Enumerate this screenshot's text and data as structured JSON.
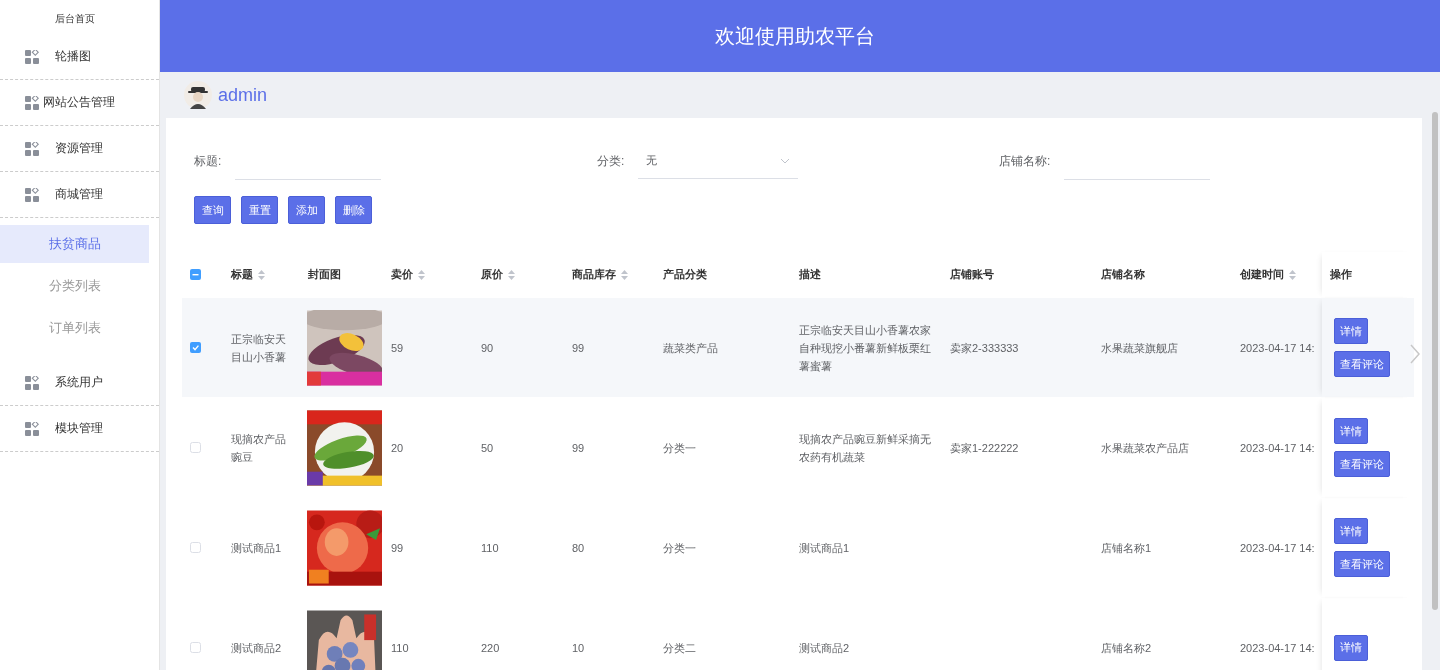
{
  "sidebar": {
    "title": "后台首页",
    "items": [
      {
        "label": "轮播图",
        "selected": false
      },
      {
        "label": "网站公告管理",
        "selected": false
      },
      {
        "label": "资源管理",
        "selected": false
      },
      {
        "label": "商城管理",
        "selected": false,
        "children": [
          {
            "label": "扶贫商品",
            "selected": true
          },
          {
            "label": "分类列表",
            "selected": false
          },
          {
            "label": "订单列表",
            "selected": false
          }
        ]
      },
      {
        "label": "系统用户",
        "selected": false
      },
      {
        "label": "模块管理",
        "selected": false
      }
    ]
  },
  "header": {
    "title": "欢迎使用助农平台"
  },
  "user": {
    "name": "admin"
  },
  "search": {
    "fields": [
      {
        "kind": "input",
        "label": "标题:"
      },
      {
        "kind": "select",
        "label": "分类:",
        "value": "无"
      },
      {
        "kind": "input",
        "label": "店铺名称:"
      }
    ],
    "buttons": [
      "查询",
      "重置",
      "添加",
      "删除"
    ]
  },
  "table": {
    "header_checkbox": {
      "checked": false,
      "indeterminate": true
    },
    "columns": [
      {
        "label": "标题",
        "sortable": true,
        "kind": "text"
      },
      {
        "label": "封面图",
        "sortable": false,
        "kind": "picture"
      },
      {
        "label": "卖价",
        "sortable": true,
        "kind": "text"
      },
      {
        "label": "原价",
        "sortable": true,
        "kind": "text"
      },
      {
        "label": "商品库存",
        "sortable": true,
        "kind": "text"
      },
      {
        "label": "产品分类",
        "sortable": false,
        "kind": "text"
      },
      {
        "label": "描述",
        "sortable": false,
        "kind": "text"
      },
      {
        "label": "店铺账号",
        "sortable": false,
        "kind": "text"
      },
      {
        "label": "店铺名称",
        "sortable": false,
        "kind": "text"
      },
      {
        "label": "创建时间",
        "sortable": true,
        "kind": "text"
      },
      {
        "label": "操作",
        "sortable": false,
        "kind": "actions"
      }
    ],
    "rows": [
      {
        "selected": true,
        "cells": [
          "正宗临安天目山小香薯",
          {
            "kind": "picture"
          },
          "59",
          "90",
          "99",
          "蔬菜类产品",
          "正宗临安天目山小香薯农家自种现挖小番薯新鲜板栗红薯蜜薯",
          "卖家2-333333",
          "水果蔬菜旗舰店",
          "2023-04-17 14:",
          [
            "详情",
            "查看评论"
          ]
        ]
      },
      {
        "selected": false,
        "cells": [
          "现摘农产品豌豆",
          {
            "kind": "picture"
          },
          "20",
          "50",
          "99",
          "分类一",
          "现摘农产品豌豆新鲜采摘无农药有机蔬菜",
          "卖家1-222222",
          "水果蔬菜农产品店",
          "2023-04-17 14:",
          [
            "详情",
            "查看评论"
          ]
        ]
      },
      {
        "selected": false,
        "cells": [
          "测试商品1",
          {
            "kind": "picture"
          },
          "99",
          "110",
          "80",
          "分类一",
          "测试商品1",
          null,
          "店铺名称1",
          "2023-04-17 14:",
          [
            "详情",
            "查看评论"
          ]
        ]
      },
      {
        "selected": false,
        "cells": [
          "测试商品2",
          {
            "kind": "picture"
          },
          "110",
          "220",
          "10",
          "分类二",
          "测试商品2",
          null,
          "店铺名称2",
          "2023-04-17 14:",
          [
            "详情"
          ]
        ]
      }
    ]
  }
}
